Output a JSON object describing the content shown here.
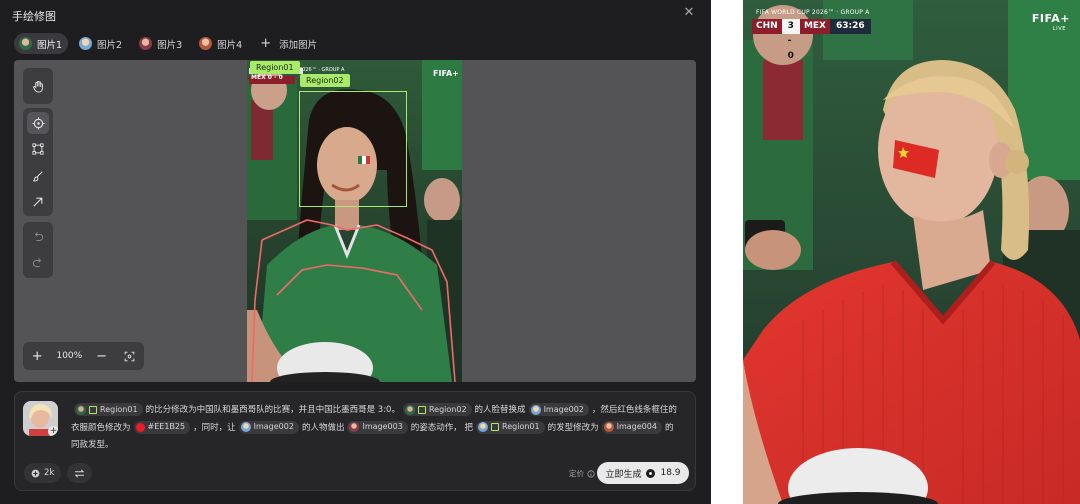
{
  "panel": {
    "title": "手绘修图",
    "close_icon": "close-icon"
  },
  "tabs": [
    {
      "label": "图片1",
      "active": true
    },
    {
      "label": "图片2",
      "active": false
    },
    {
      "label": "图片3",
      "active": false
    },
    {
      "label": "图片4",
      "active": false
    }
  ],
  "add_tab": {
    "label": "添加图片"
  },
  "tools": {
    "hand": "hand-icon",
    "target": "target-icon",
    "rect": "rectangle-select-icon",
    "brush": "brush-icon",
    "arrow": "arrow-icon",
    "undo": "undo-icon",
    "redo": "redo-icon"
  },
  "zoom": {
    "level": "100%"
  },
  "canvas_overlays": {
    "region1": "Region01",
    "region2": "Region02",
    "mini_score": "MEX  0 - 0",
    "mini_wc": "2026™ · GROUP A",
    "mini_fifa": "FIFA+"
  },
  "prompt": {
    "seg1": "的比分修改为中国队和墨西哥队的比赛，并且中国比墨西哥是 3:0。",
    "seg2": "的人脸替换成",
    "seg3": "，然后红色线条框住的衣服颜色修改为",
    "seg4": "，同时，让",
    "seg5": "的人物做出",
    "seg6": "的姿态动作，",
    "seg7": "把",
    "seg8": "的发型修改为",
    "seg9": "的同款发型。",
    "chip_region01": "Region01",
    "chip_region02": "Region02",
    "chip_image002": "Image002",
    "chip_image003": "Image003",
    "chip_image004": "Image004",
    "chip_color": "#EE1B25",
    "color_value": "#EE1B25"
  },
  "prompt_footer": {
    "count": "2k",
    "price_label": "定价",
    "generate_label": "立即生成",
    "credits": "18.9"
  },
  "result": {
    "wc_title": "FIFA WORLD CUP 2026™ · GROUP A",
    "team1": "CHN",
    "score": "3 - 0",
    "team2": "MEX",
    "clock": "63:26",
    "fifa": "FIFA+",
    "live": "LIVE"
  },
  "colors": {
    "accent_green": "#a9ea6a",
    "shirt_red": "#EE1B25",
    "panel_bg": "#1e1e20"
  }
}
